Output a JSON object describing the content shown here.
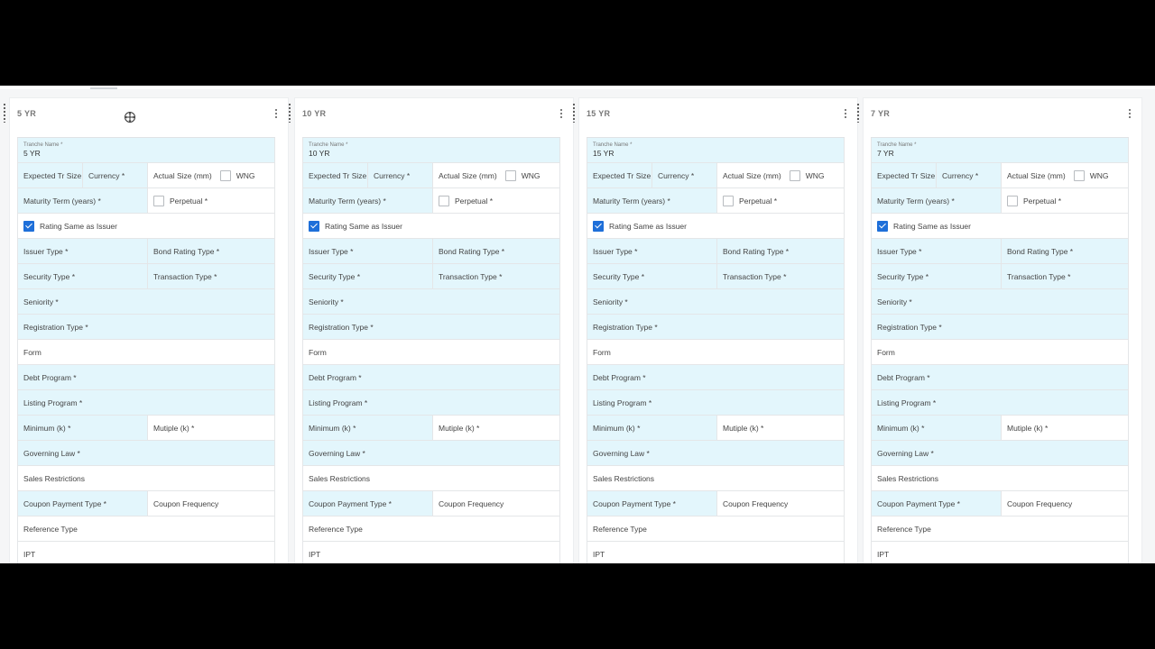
{
  "cards": [
    {
      "title": "5 YR",
      "tranche_name_label": "Tranche Name *",
      "tranche_name_value": "5 YR"
    },
    {
      "title": "10 YR",
      "tranche_name_label": "Tranche Name *",
      "tranche_name_value": "10 YR"
    },
    {
      "title": "15 YR",
      "tranche_name_label": "Tranche Name *",
      "tranche_name_value": "15 YR"
    },
    {
      "title": "7 YR",
      "tranche_name_label": "Tranche Name *",
      "tranche_name_value": "7 YR"
    }
  ],
  "fields": {
    "expected_tr_size": "Expected Tr Size",
    "currency": "Currency *",
    "actual_size": "Actual Size (mm)",
    "wng": "WNG",
    "maturity_term": "Maturity Term (years) *",
    "perpetual": "Perpetual *",
    "rating_same_as_issuer": "Rating Same as Issuer",
    "issuer_type": "Issuer Type *",
    "bond_rating_type": "Bond Rating Type *",
    "security_type": "Security Type *",
    "transaction_type": "Transaction Type *",
    "seniority": "Seniority *",
    "registration_type": "Registration Type *",
    "form": "Form",
    "debt_program": "Debt Program *",
    "listing_program": "Listing Program *",
    "minimum": "Minimum (k) *",
    "multiple": "Mutiple (k) *",
    "governing_law": "Governing Law *",
    "sales_restrictions": "Sales Restrictions",
    "coupon_payment_type": "Coupon Payment Type *",
    "coupon_frequency": "Coupon Frequency",
    "reference_type": "Reference Type",
    "ipt": "IPT"
  },
  "colors": {
    "required_bg": "#e3f6fc",
    "check_blue": "#1e6fd9",
    "frame": "#000000"
  }
}
